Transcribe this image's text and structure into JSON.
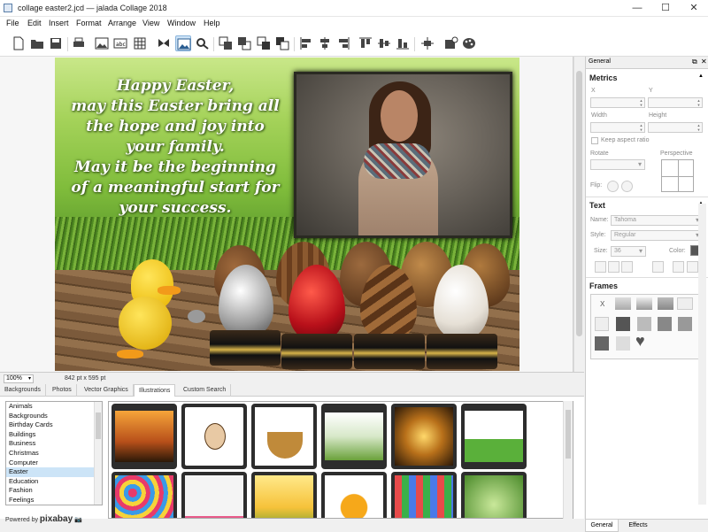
{
  "window": {
    "title": "collage easter2.jcd — jalada Collage 2018",
    "minimize": "—",
    "maximize": "☐",
    "close": "✕"
  },
  "menu": [
    "File",
    "Edit",
    "Insert",
    "Format",
    "Arrange",
    "View",
    "Window",
    "Help"
  ],
  "toolbar": {
    "icons": [
      "new-file",
      "open-folder",
      "save",
      "print",
      "insert-image",
      "insert-text",
      "insert-table",
      "butterfly-clipart",
      "background-image",
      "magnifier",
      "bring-forward",
      "send-backward",
      "bring-to-front",
      "send-to-back",
      "align-left",
      "align-center",
      "align-right",
      "align-top",
      "align-middle",
      "align-bottom",
      "distribute",
      "page-setup",
      "color-palette"
    ],
    "active": "background-image"
  },
  "canvas": {
    "greeting_lines": [
      "Happy Easter,",
      "may this Easter bring all",
      "the hope and joy into",
      "your family.",
      "May it be the beginning",
      "of a meaningful start for",
      "your success."
    ]
  },
  "status": {
    "zoom": "100%",
    "size": "842 pt x 595 pt"
  },
  "library": {
    "tabs": [
      "Backgrounds",
      "Photos",
      "Vector Graphics",
      "Illustrations",
      "Custom Search"
    ],
    "active_tab": "Illustrations",
    "categories": [
      "Animals",
      "Backgrounds",
      "Birthday Cards",
      "Buildings",
      "Business",
      "Christmas",
      "Computer",
      "Easter",
      "Education",
      "Fashion",
      "Feelings"
    ],
    "selected_category": "Easter",
    "powered_by": "Powered by",
    "pixabay": "pixabay"
  },
  "panel": {
    "header": "General",
    "metrics": {
      "title": "Metrics",
      "x": "X",
      "y": "Y",
      "width": "Width",
      "height": "Height",
      "keep_aspect": "Keep aspect ratio",
      "rotate": "Rotate",
      "perspective": "Perspective",
      "flip": "Flip:"
    },
    "text": {
      "title": "Text",
      "name_label": "Name:",
      "name_value": "Tahoma",
      "style_label": "Style:",
      "style_value": "Regular",
      "size_label": "Size:",
      "size_value": "36",
      "color_label": "Color:"
    },
    "frames": {
      "title": "Frames",
      "none": "X"
    },
    "tabs": [
      "General",
      "Effects"
    ]
  }
}
